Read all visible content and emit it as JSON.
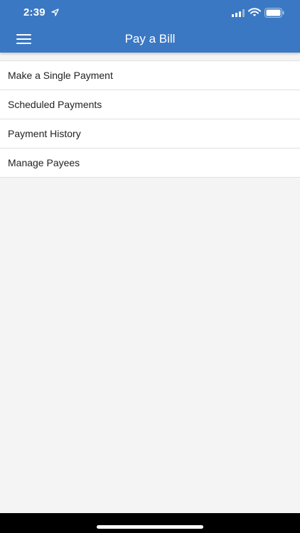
{
  "status_bar": {
    "time": "2:39",
    "icons": [
      "location-arrow-icon",
      "cellular-signal-icon",
      "wifi-icon",
      "battery-icon"
    ]
  },
  "nav": {
    "title": "Pay a Bill",
    "menu_icon": "hamburger-menu-icon"
  },
  "menu": {
    "items": [
      {
        "label": "Make a Single Payment"
      },
      {
        "label": "Scheduled Payments"
      },
      {
        "label": "Payment History"
      },
      {
        "label": "Manage Payees"
      }
    ]
  },
  "colors": {
    "header": "#3b78c3",
    "background": "#f4f4f5",
    "list_background": "#ffffff",
    "text": "#222222",
    "divider": "#e1e1e3"
  }
}
